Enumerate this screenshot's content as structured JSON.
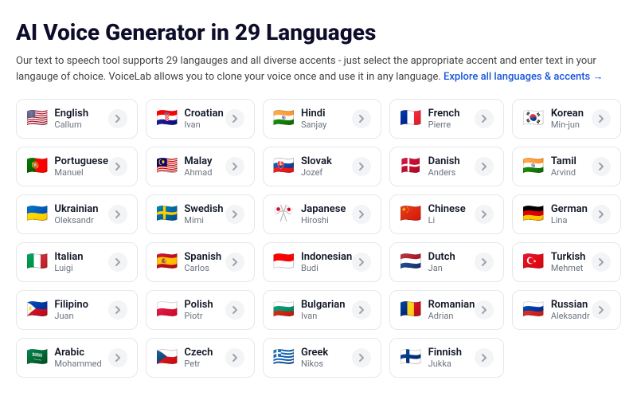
{
  "page": {
    "title": "AI Voice Generator in 29 Languages",
    "subtitle": "Our text to speech tool supports 29 langauges and all diverse accents - just select the appropriate accent and enter text in your langauge of choice. VoiceLab allows you to clone your voice once and use it in any language.",
    "link_text": "Explore all languages & accents →"
  },
  "languages": [
    {
      "name": "English",
      "voice": "Callum",
      "flag": "🇺🇸"
    },
    {
      "name": "Croatian",
      "voice": "Ivan",
      "flag": "🇭🇷"
    },
    {
      "name": "Hindi",
      "voice": "Sanjay",
      "flag": "🇮🇳"
    },
    {
      "name": "French",
      "voice": "Pierre",
      "flag": "🇫🇷"
    },
    {
      "name": "Korean",
      "voice": "Min-jun",
      "flag": "🇰🇷"
    },
    {
      "name": "Portuguese",
      "voice": "Manuel",
      "flag": "🇵🇹"
    },
    {
      "name": "Malay",
      "voice": "Ahmad",
      "flag": "🇲🇾"
    },
    {
      "name": "Slovak",
      "voice": "Jozef",
      "flag": "🇸🇰"
    },
    {
      "name": "Danish",
      "voice": "Anders",
      "flag": "🇩🇰"
    },
    {
      "name": "Tamil",
      "voice": "Arvind",
      "flag": "🇮🇳"
    },
    {
      "name": "Ukrainian",
      "voice": "Oleksandr",
      "flag": "🇺🇦"
    },
    {
      "name": "Swedish",
      "voice": "Mimi",
      "flag": "🇸🇪"
    },
    {
      "name": "Japanese",
      "voice": "Hiroshi",
      "flag": "🎌"
    },
    {
      "name": "Chinese",
      "voice": "Li",
      "flag": "🇨🇳"
    },
    {
      "name": "German",
      "voice": "Lina",
      "flag": "🇩🇪"
    },
    {
      "name": "Italian",
      "voice": "Luigi",
      "flag": "🇮🇹"
    },
    {
      "name": "Spanish",
      "voice": "Carlos",
      "flag": "🇪🇸"
    },
    {
      "name": "Indonesian",
      "voice": "Budi",
      "flag": "🇮🇩"
    },
    {
      "name": "Dutch",
      "voice": "Jan",
      "flag": "🇳🇱"
    },
    {
      "name": "Turkish",
      "voice": "Mehmet",
      "flag": "🇹🇷"
    },
    {
      "name": "Filipino",
      "voice": "Juan",
      "flag": "🇵🇭"
    },
    {
      "name": "Polish",
      "voice": "Piotr",
      "flag": "🇵🇱"
    },
    {
      "name": "Bulgarian",
      "voice": "Ivan",
      "flag": "🇧🇬"
    },
    {
      "name": "Romanian",
      "voice": "Adrian",
      "flag": "🇷🇴"
    },
    {
      "name": "Russian",
      "voice": "Aleksandr",
      "flag": "🇷🇺"
    },
    {
      "name": "Arabic",
      "voice": "Mohammed",
      "flag": "🇸🇦"
    },
    {
      "name": "Czech",
      "voice": "Petr",
      "flag": "🇨🇿"
    },
    {
      "name": "Greek",
      "voice": "Nikos",
      "flag": "🇬🇷"
    },
    {
      "name": "Finnish",
      "voice": "Jukka",
      "flag": "🇫🇮"
    }
  ]
}
